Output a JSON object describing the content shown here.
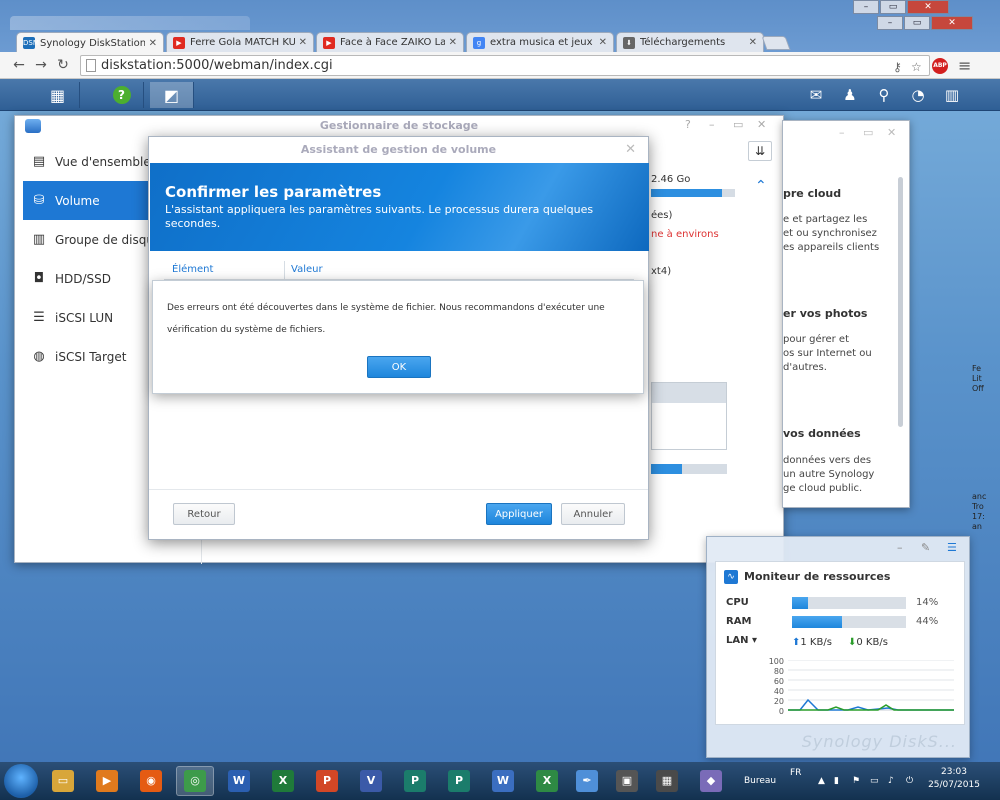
{
  "browser": {
    "tabs": [
      {
        "label": "Synology DiskStation - Di",
        "icon": "diskstation-favicon",
        "fav": "DSM"
      },
      {
        "label": "Ferre Gola MATCH KUATA",
        "icon": "youtube-favicon",
        "fav": "▶"
      },
      {
        "label": "Face à Face ZAIKO Lan",
        "icon": "youtube-favicon",
        "fav": "▶"
      },
      {
        "label": "extra musica et jeux africa",
        "icon": "google-favicon",
        "fav": "g"
      },
      {
        "label": "Téléchargements",
        "icon": "download-favicon",
        "fav": "⬇"
      }
    ],
    "tab_close": "✕",
    "url": "diskstation:5000/webman/index.cgi",
    "abp": "ABP"
  },
  "storage_manager": {
    "title": "Gestionnaire de stockage",
    "nav": [
      {
        "label": "Vue d'ensemble",
        "icon": "overview-icon",
        "glyph": "▤"
      },
      {
        "label": "Volume",
        "icon": "volume-icon",
        "glyph": "⛁"
      },
      {
        "label": "Groupe de disque",
        "icon": "disk-group-icon",
        "glyph": "▥"
      },
      {
        "label": "HDD/SSD",
        "icon": "hdd-icon",
        "glyph": "◘"
      },
      {
        "label": "iSCSI LUN",
        "icon": "iscsi-lun-icon",
        "glyph": "☰"
      },
      {
        "label": "iSCSI Target",
        "icon": "globe-icon",
        "glyph": "◍"
      }
    ],
    "fragments": {
      "size": "2.46 Go",
      "line1": "ées)",
      "line2": "ne à environs",
      "line3": "xt4)"
    },
    "usage_fraction": 0.84,
    "usage_fraction_2": 0.41
  },
  "wizard": {
    "title": "Assistant de gestion de volume",
    "heading": "Confirmer les paramètres",
    "description": "L'assistant appliquera les paramètres suivants. Le processus durera quelques secondes.",
    "col_element": "Élément",
    "col_value": "Valeur",
    "back": "Retour",
    "apply": "Appliquer",
    "cancel": "Annuler"
  },
  "error_dialog": {
    "message": "Des erreurs ont été découvertes dans le système de fichier. Nous recommandons d'exécuter une vérification du système de fichiers.",
    "ok": "OK"
  },
  "cloud_panel": {
    "t1": "pre cloud",
    "d1": "e et partagez les\net ou synchronisez\nes appareils clients",
    "t2": "er vos photos",
    "d2": "pour gérer et\nos sur Internet ou\nd'autres.",
    "t3": "vos données",
    "d3": "données vers des\nun autre Synology\nge cloud public."
  },
  "resource_monitor": {
    "title": "Moniteur de ressources",
    "cpu_label": "CPU",
    "cpu_pct": "14%",
    "cpu_value": 14,
    "ram_label": "RAM",
    "ram_pct": "44%",
    "ram_value": 44,
    "lan_label": "LAN ▾",
    "lan_up": "1 KB/s",
    "lan_down": "0 KB/s",
    "y_ticks": [
      "100",
      "80",
      "60",
      "40",
      "20",
      "0"
    ],
    "watermark": "Synology DiskS..."
  },
  "desktop_right": {
    "l1": "Fe\nLit\nOff",
    "l2": "anc\nTro\n17:\nan"
  },
  "taskbar": {
    "apps": [
      {
        "icon": "explorer-icon",
        "glyph": "▭",
        "color": "#d8a63a"
      },
      {
        "icon": "media-player-icon",
        "glyph": "▶",
        "color": "#e07a1d"
      },
      {
        "icon": "firefox-icon",
        "glyph": "◉",
        "color": "#e55b13"
      },
      {
        "icon": "chrome-icon",
        "glyph": "◎",
        "color": "#3d9b4a"
      },
      {
        "icon": "word-icon",
        "glyph": "W",
        "color": "#2b5fb1"
      },
      {
        "icon": "excel-icon",
        "glyph": "X",
        "color": "#1f7a3a"
      },
      {
        "icon": "powerpoint-icon",
        "glyph": "P",
        "color": "#d24726"
      },
      {
        "icon": "visio-icon",
        "glyph": "V",
        "color": "#3b5aa8"
      },
      {
        "icon": "publisher-icon",
        "glyph": "P",
        "color": "#1b7c6b"
      },
      {
        "icon": "publisher-icon",
        "glyph": "P",
        "color": "#1b7c6b"
      },
      {
        "icon": "word-doc-icon",
        "glyph": "W",
        "color": "#3b6ec0"
      },
      {
        "icon": "excel-doc-icon",
        "glyph": "X",
        "color": "#2e8a44"
      },
      {
        "icon": "feather-icon",
        "glyph": "✒",
        "color": "#4f8fd8"
      },
      {
        "icon": "monitor-icon",
        "glyph": "▣",
        "color": "#555555"
      },
      {
        "icon": "film-icon",
        "glyph": "▦",
        "color": "#4a4a4a"
      },
      {
        "icon": "package-icon",
        "glyph": "◆",
        "color": "#7a6bb8"
      }
    ],
    "desktop_label": "Bureau",
    "lang": "FR",
    "time": "23:03",
    "date": "25/07/2015"
  }
}
